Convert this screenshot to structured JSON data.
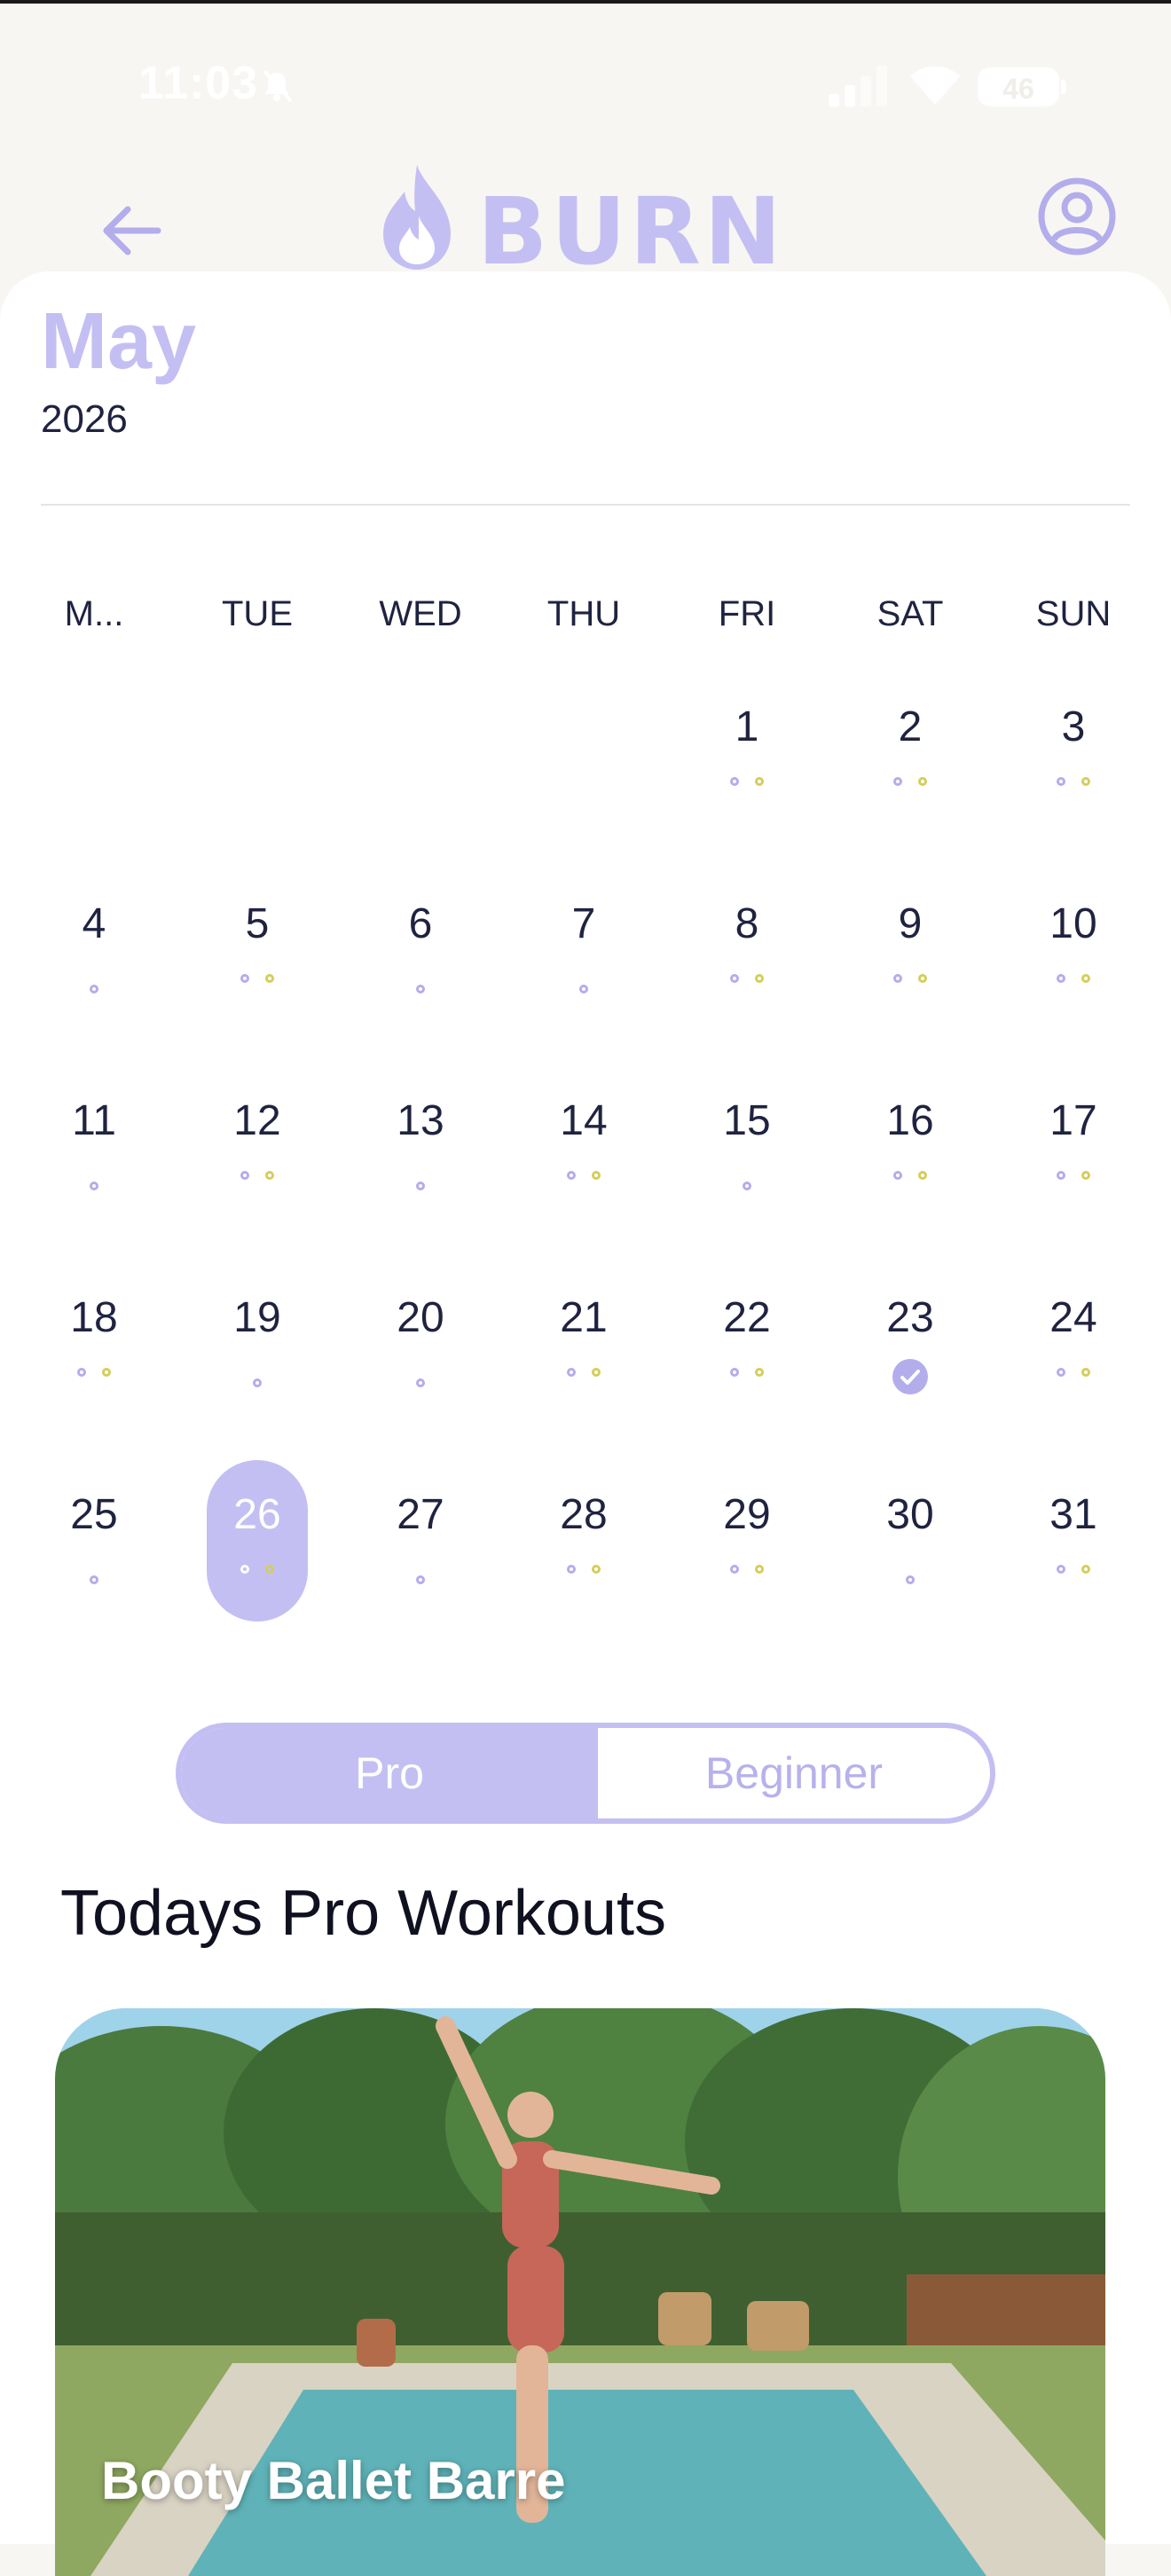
{
  "status_bar": {
    "time": "11:03",
    "battery": "46",
    "icons": [
      "mute-icon",
      "signal-icon",
      "wifi-icon",
      "battery-icon"
    ]
  },
  "header": {
    "logo_text": "BURN",
    "icons": [
      "back-arrow-icon",
      "flame-logo-icon",
      "profile-icon"
    ]
  },
  "calendar": {
    "month": "May",
    "year": "2026",
    "weekdays": [
      "M...",
      "TUE",
      "WED",
      "THU",
      "FRI",
      "SAT",
      "SUN"
    ],
    "selected_day": 26,
    "days": [
      {
        "day": "1",
        "dots": [
          "p",
          "y"
        ]
      },
      {
        "day": "2",
        "dots": [
          "p",
          "y"
        ]
      },
      {
        "day": "3",
        "dots": [
          "p",
          "y"
        ]
      },
      {
        "day": "4",
        "dots": [
          "p"
        ]
      },
      {
        "day": "5",
        "dots": [
          "p",
          "y"
        ]
      },
      {
        "day": "6",
        "dots": [
          "p"
        ]
      },
      {
        "day": "7",
        "dots": [
          "p"
        ]
      },
      {
        "day": "8",
        "dots": [
          "p",
          "y"
        ]
      },
      {
        "day": "9",
        "dots": [
          "p",
          "y"
        ]
      },
      {
        "day": "10",
        "dots": [
          "p",
          "y"
        ]
      },
      {
        "day": "11",
        "dots": [
          "p"
        ]
      },
      {
        "day": "12",
        "dots": [
          "p",
          "y"
        ]
      },
      {
        "day": "13",
        "dots": [
          "p"
        ]
      },
      {
        "day": "14",
        "dots": [
          "p",
          "y"
        ]
      },
      {
        "day": "15",
        "dots": [
          "p"
        ]
      },
      {
        "day": "16",
        "dots": [
          "p",
          "y"
        ]
      },
      {
        "day": "17",
        "dots": [
          "p",
          "y"
        ]
      },
      {
        "day": "18",
        "dots": [
          "p",
          "y"
        ]
      },
      {
        "day": "19",
        "dots": [
          "p"
        ]
      },
      {
        "day": "20",
        "dots": [
          "p"
        ]
      },
      {
        "day": "21",
        "dots": [
          "p",
          "y"
        ]
      },
      {
        "day": "22",
        "dots": [
          "p",
          "y"
        ]
      },
      {
        "day": "23",
        "dots": [
          "check"
        ]
      },
      {
        "day": "24",
        "dots": [
          "p",
          "y"
        ]
      },
      {
        "day": "25",
        "dots": [
          "p"
        ]
      },
      {
        "day": "26",
        "dots": [
          "p",
          "y"
        ]
      },
      {
        "day": "27",
        "dots": [
          "p"
        ]
      },
      {
        "day": "28",
        "dots": [
          "p",
          "y"
        ]
      },
      {
        "day": "29",
        "dots": [
          "p",
          "y"
        ]
      },
      {
        "day": "30",
        "dots": [
          "p"
        ]
      },
      {
        "day": "31",
        "dots": [
          "p",
          "y"
        ]
      }
    ]
  },
  "toggle": {
    "pro_label": "Pro",
    "beginner_label": "Beginner",
    "active": "Pro"
  },
  "section_title": "Todays Pro Workouts",
  "workouts": [
    {
      "title": "Booty Ballet Barre"
    }
  ],
  "colors": {
    "accent": "#c4bff2",
    "dot_purple": "#b3adec",
    "dot_yellow": "#d4ce5a",
    "text_dark": "#1f2340",
    "header_bg": "#f7f6f3"
  }
}
